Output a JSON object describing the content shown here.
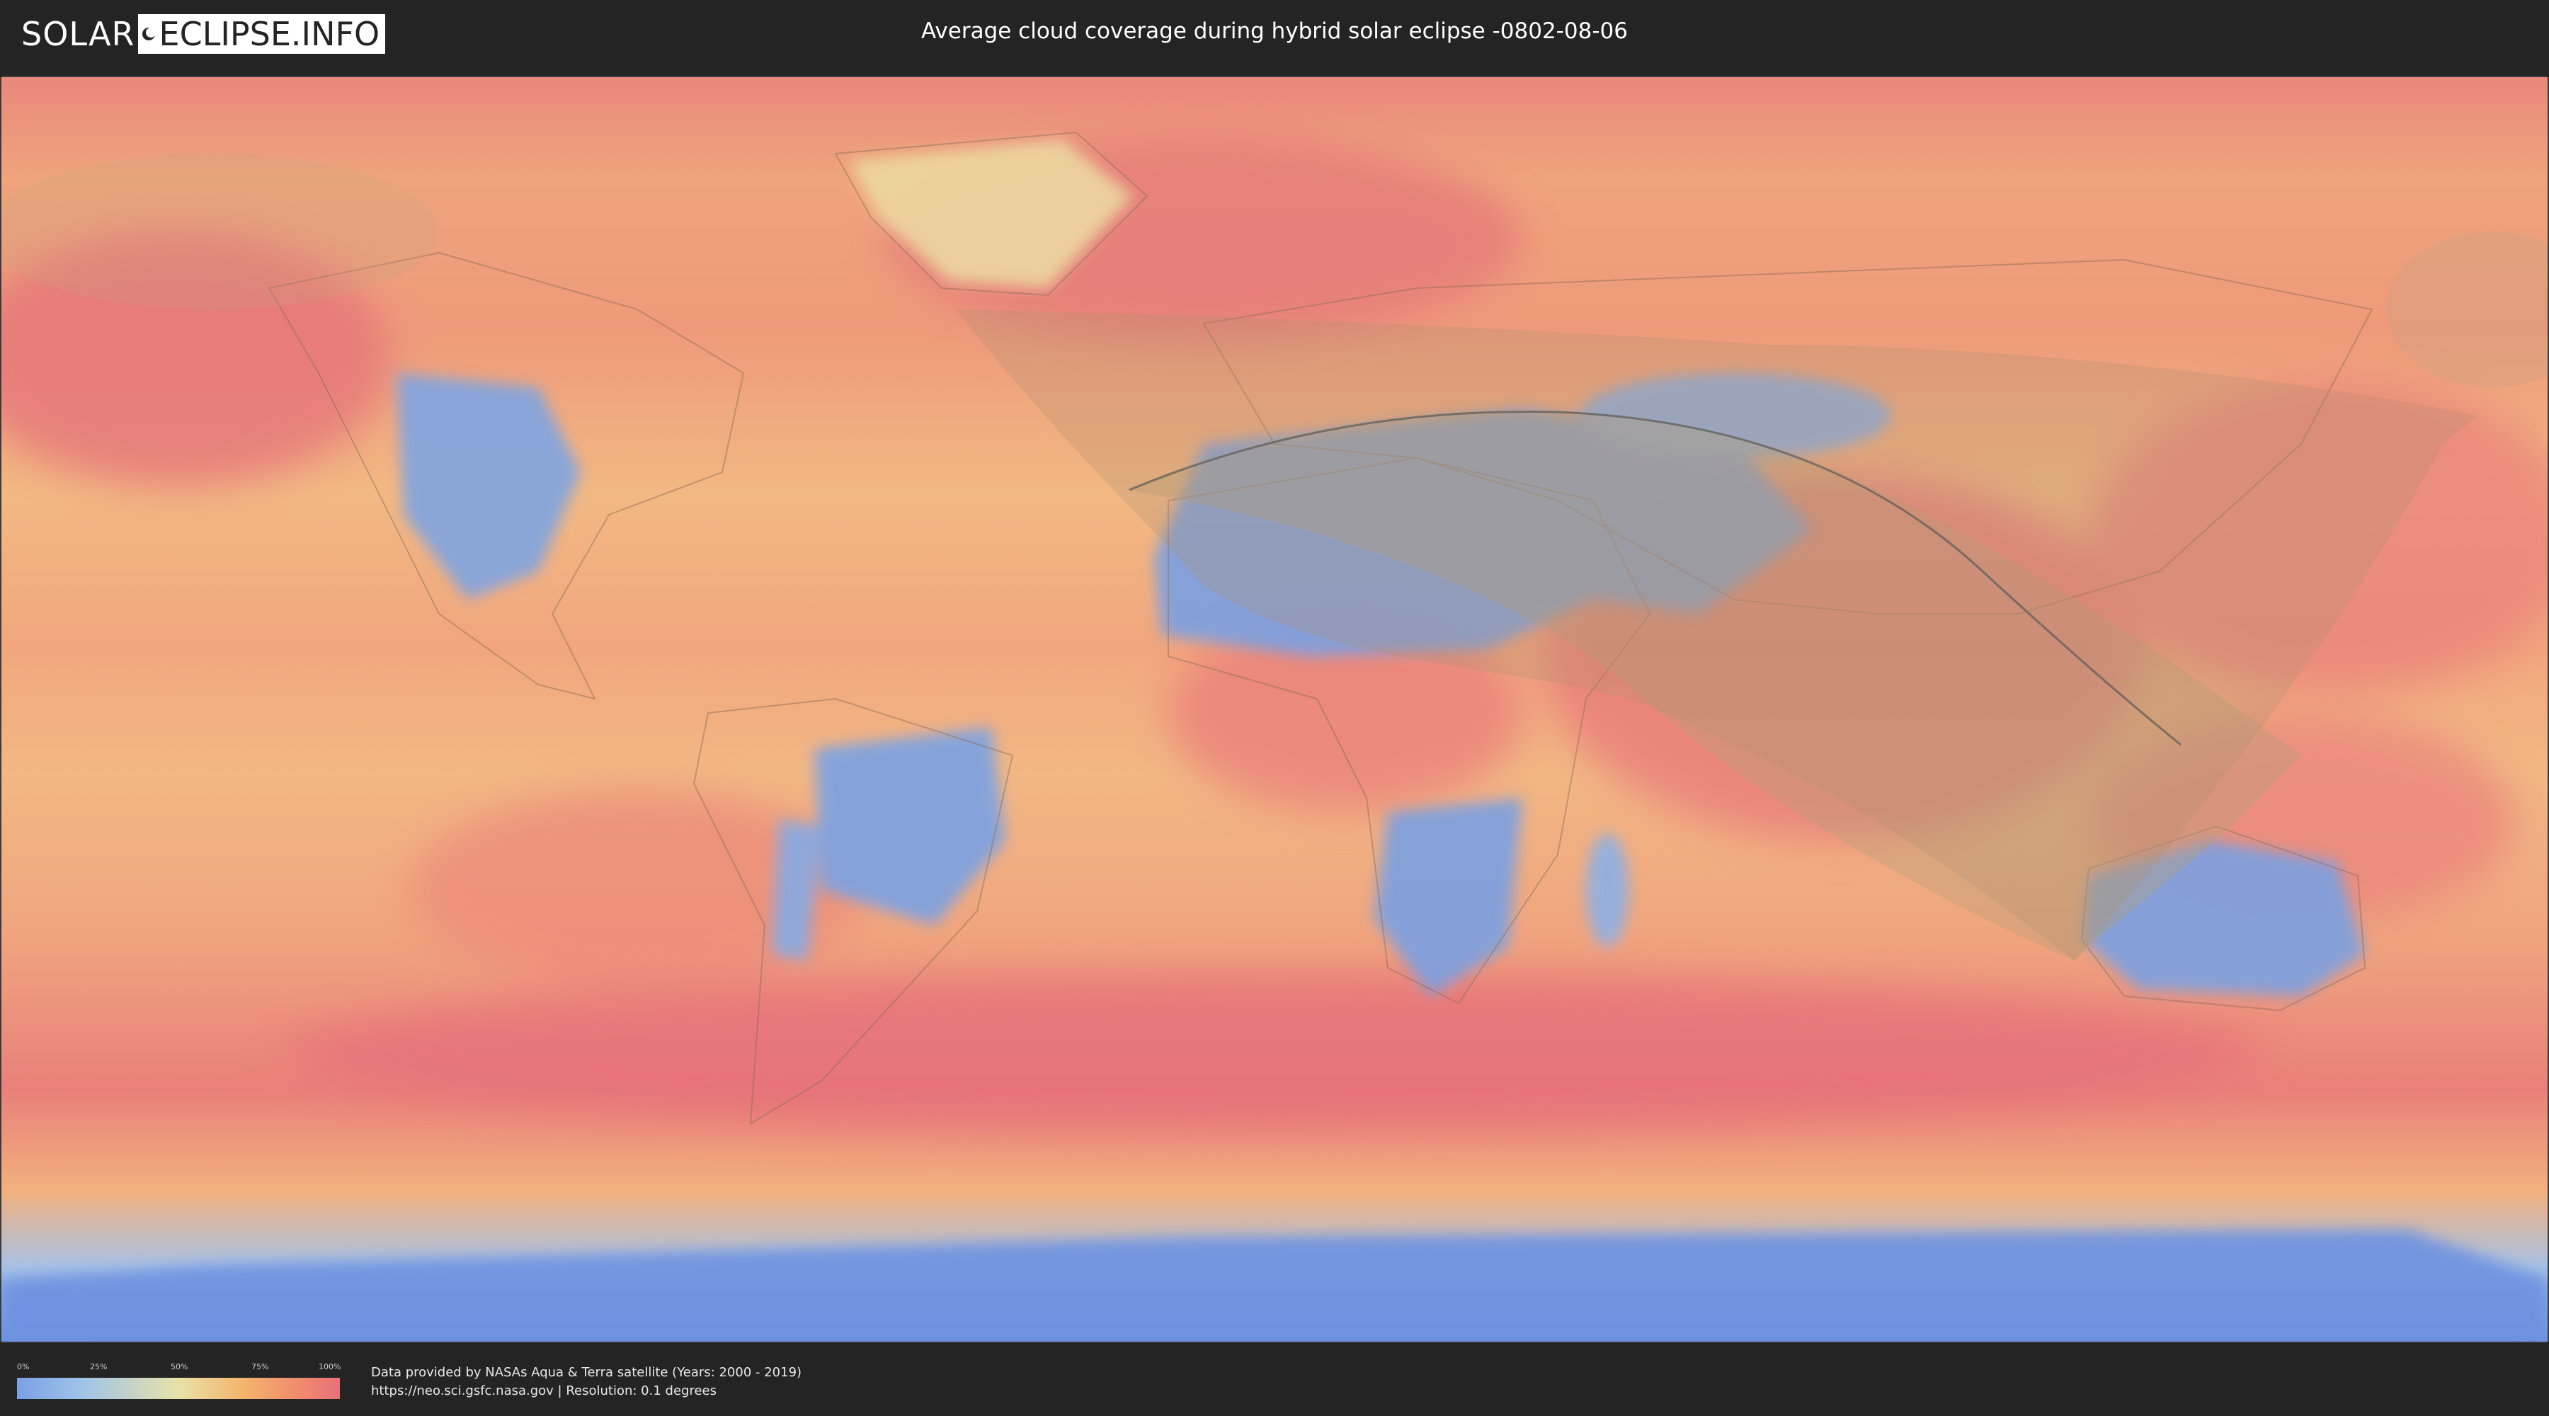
{
  "header": {
    "logo_left": "SOLAR",
    "logo_right": "ECLIPSE.INFO",
    "title": "Average cloud coverage during hybrid solar eclipse -0802-08-06"
  },
  "map": {
    "type": "world cloud coverage map (equirectangular)",
    "layers": [
      "cloud-coverage",
      "country-borders",
      "eclipse-visibility-zone",
      "eclipse-path"
    ]
  },
  "legend": {
    "ticks": [
      "0%",
      "25%",
      "50%",
      "75%",
      "100%"
    ],
    "gradient_colors": [
      "#7aa0e6",
      "#9fc3e8",
      "#e8e2a8",
      "#f4b46c",
      "#f08a6e",
      "#e8707a"
    ]
  },
  "footer": {
    "credit_line1": "Data provided by NASAs Aqua & Terra satellite (Years: 2000 - 2019)",
    "credit_line2": "https://neo.sci.gsfc.nasa.gov | Resolution: 0.1 degrees"
  },
  "colors": {
    "background": "#242424",
    "clear_sky": "#7aa0e6",
    "overcast": "#e8707a",
    "eclipse_zone": "#b4a078"
  }
}
